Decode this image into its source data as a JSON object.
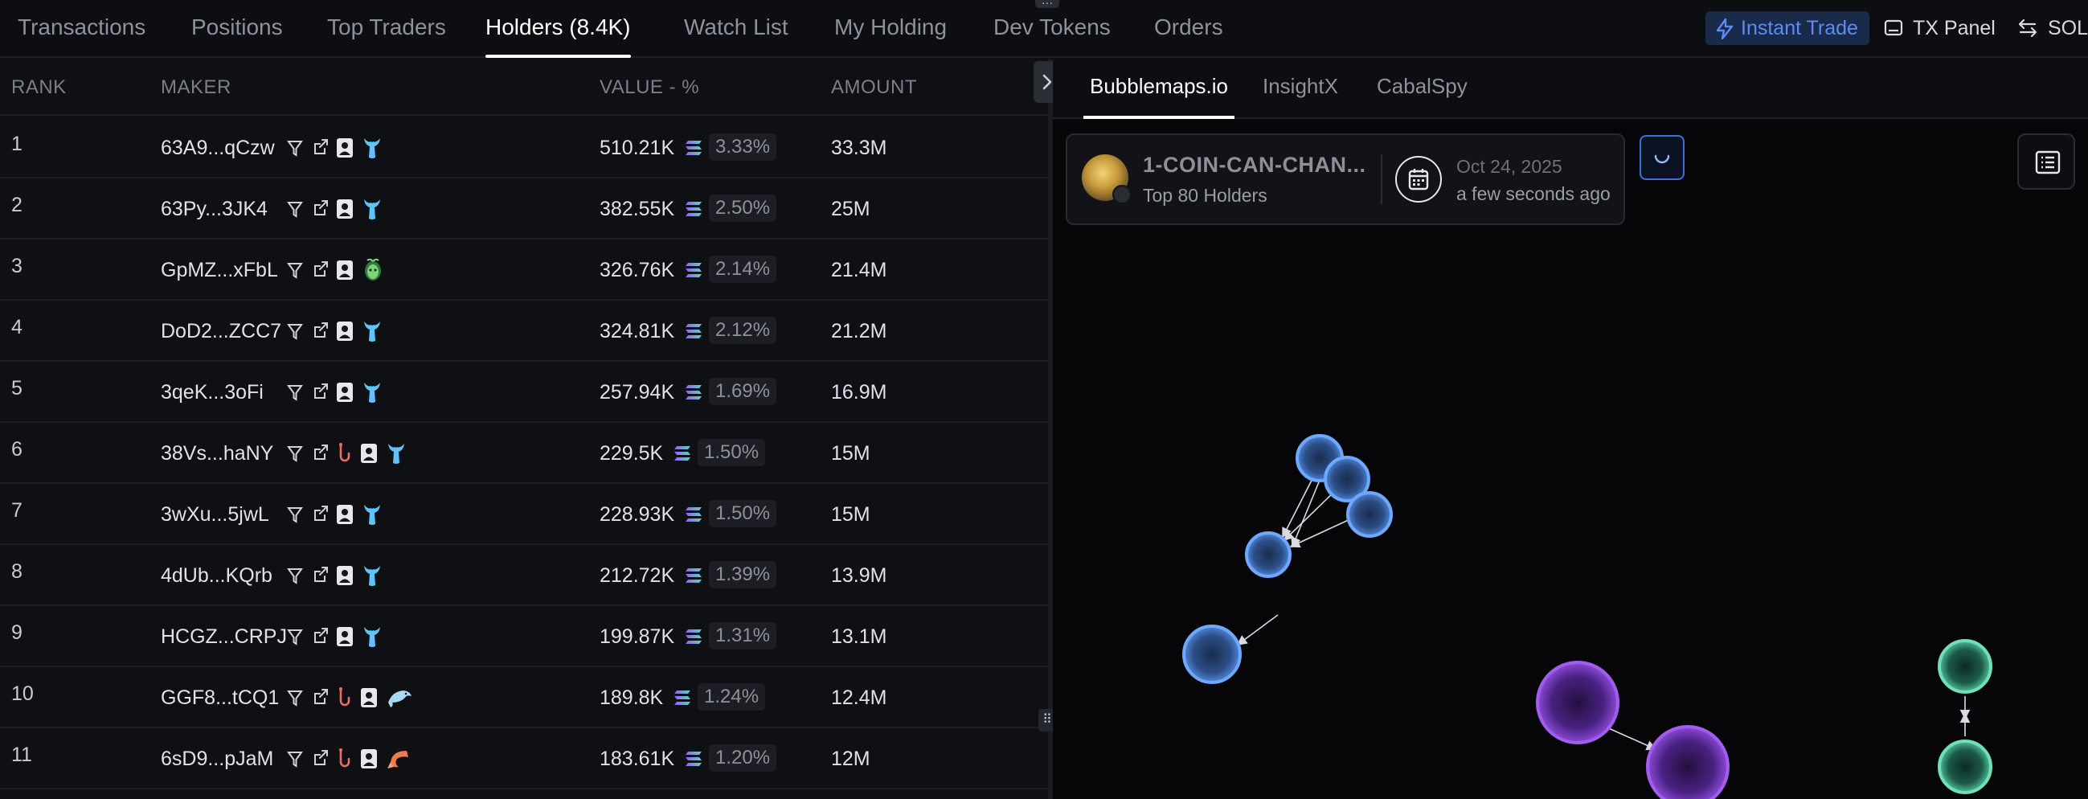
{
  "top_tabs": [
    {
      "label": "Transactions"
    },
    {
      "label": "Positions"
    },
    {
      "label": "Top Traders"
    },
    {
      "label": "Holders (8.4K)"
    },
    {
      "label": "Watch List"
    },
    {
      "label": "My Holding"
    },
    {
      "label": "Dev Tokens"
    },
    {
      "label": "Orders"
    }
  ],
  "active_tab": "Holders (8.4K)",
  "top_right": {
    "instant_trade": "Instant Trade",
    "tx_panel": "TX Panel",
    "sol": "SOL"
  },
  "table": {
    "headers": {
      "rank": "RANK",
      "maker": "MAKER",
      "value": "VALUE - %",
      "amount": "AMOUNT"
    },
    "rows": [
      {
        "rank": "1",
        "maker": "63A9...qCzw",
        "value": "510.21K",
        "pct": "3.33%",
        "amount": "33.3M",
        "badge": "whale",
        "hook": false
      },
      {
        "rank": "2",
        "maker": "63Py...3JK4",
        "value": "382.55K",
        "pct": "2.50%",
        "amount": "25M",
        "badge": "whale",
        "hook": false
      },
      {
        "rank": "3",
        "maker": "GpMZ...xFbL",
        "value": "326.76K",
        "pct": "2.14%",
        "amount": "21.4M",
        "badge": "sprout",
        "hook": false
      },
      {
        "rank": "4",
        "maker": "DoD2...ZCC7",
        "value": "324.81K",
        "pct": "2.12%",
        "amount": "21.2M",
        "badge": "whale",
        "hook": false
      },
      {
        "rank": "5",
        "maker": "3qeK...3oFi",
        "value": "257.94K",
        "pct": "1.69%",
        "amount": "16.9M",
        "badge": "whale",
        "hook": false
      },
      {
        "rank": "6",
        "maker": "38Vs...haNY",
        "value": "229.5K",
        "pct": "1.50%",
        "amount": "15M",
        "badge": "whale",
        "hook": true
      },
      {
        "rank": "7",
        "maker": "3wXu...5jwL",
        "value": "228.93K",
        "pct": "1.50%",
        "amount": "15M",
        "badge": "whale",
        "hook": false
      },
      {
        "rank": "8",
        "maker": "4dUb...KQrb",
        "value": "212.72K",
        "pct": "1.39%",
        "amount": "13.9M",
        "badge": "whale",
        "hook": false
      },
      {
        "rank": "9",
        "maker": "HCGZ...CRPJ",
        "value": "199.87K",
        "pct": "1.31%",
        "amount": "13.1M",
        "badge": "whale",
        "hook": false
      },
      {
        "rank": "10",
        "maker": "GGF8...tCQ1",
        "value": "189.8K",
        "pct": "1.24%",
        "amount": "12.4M",
        "badge": "dolphin",
        "hook": true
      },
      {
        "rank": "11",
        "maker": "6sD9...pJaM",
        "value": "183.61K",
        "pct": "1.20%",
        "amount": "12M",
        "badge": "shrimp",
        "hook": true
      }
    ]
  },
  "right_tabs": [
    {
      "label": "Bubblemaps.io"
    },
    {
      "label": "InsightX"
    },
    {
      "label": "CabalSpy"
    }
  ],
  "bubblemap": {
    "token_name": "1-COIN-CAN-CHAN...",
    "subtitle": "Top 80 Holders",
    "date": "Oct 24, 2025",
    "updated": "a few seconds ago"
  },
  "colors": {
    "accent_blue": "#5d8bf4",
    "cluster_blue": "#6fa8ff",
    "cluster_purple": "#a25cf0",
    "cluster_green": "#6fe0b8",
    "whale_icon": "#5ec4ff"
  },
  "icons": [
    "filter-icon",
    "external-link-icon",
    "profile-icon",
    "whale-icon",
    "hook-icon",
    "sprout-icon",
    "dolphin-icon",
    "shrimp-icon",
    "lightning-icon",
    "calendar-icon",
    "list-icon"
  ]
}
